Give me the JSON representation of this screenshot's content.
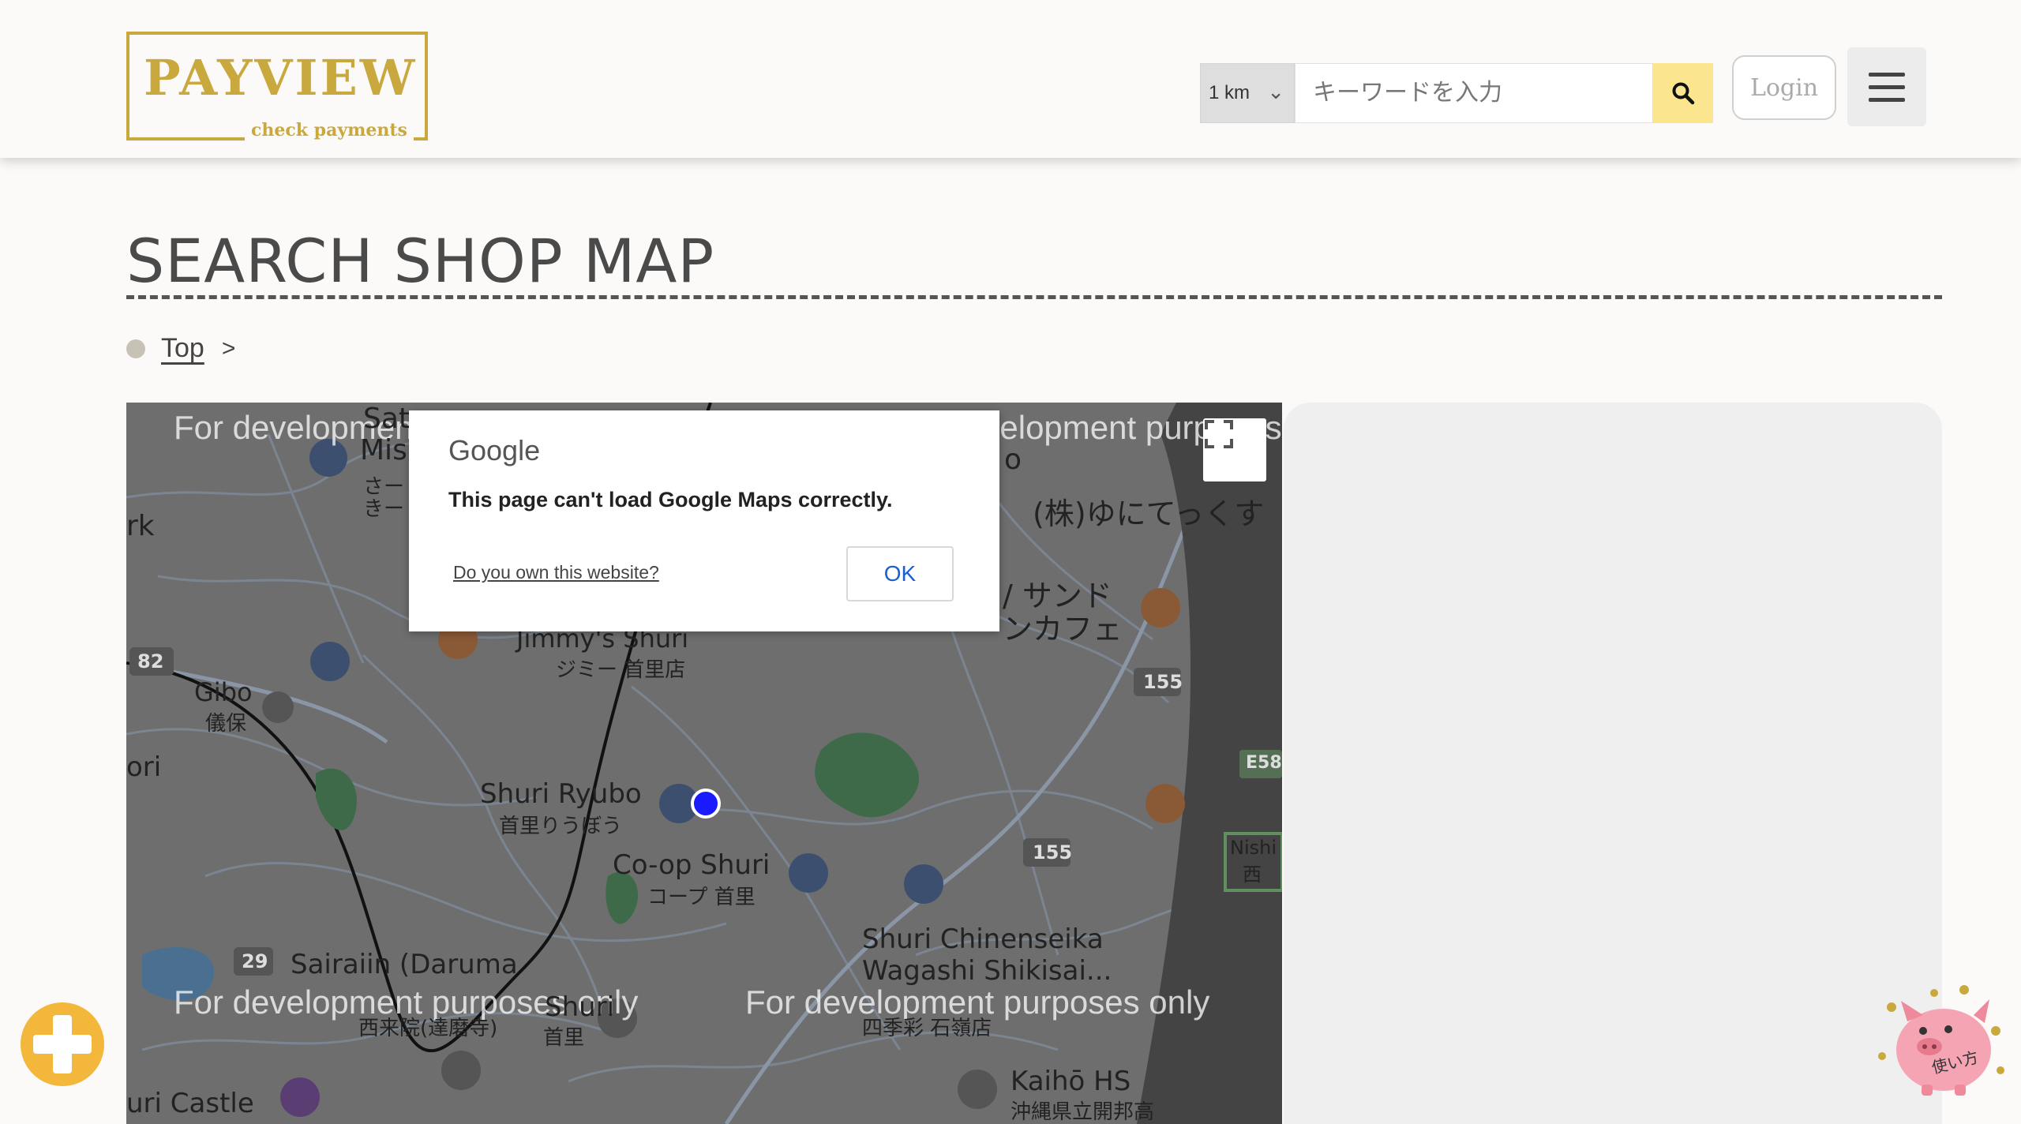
{
  "header": {
    "logo_text": "PAYVIEW",
    "logo_sub": "check payments",
    "distance_value": "1 km",
    "search_placeholder": "キーワードを入力",
    "login_label": "Login"
  },
  "page": {
    "title": "SEARCH SHOP MAP",
    "breadcrumb": [
      {
        "label": "Top"
      }
    ],
    "breadcrumb_separator": ">"
  },
  "map": {
    "watermark": "For development purposes only",
    "labels": {
      "gibo": "Gibo",
      "gibo_jp": "儀保",
      "jimmys": "Jimmy's Shuri",
      "jimmys_jp": "ジミー 首里店",
      "ryubo": "Shuri Ryubo",
      "ryubo_jp": "首里りうぼう",
      "coop": "Co-op Shuri",
      "coop_jp": "コープ 首里",
      "chinenseika": "Shuri Chinenseika",
      "wagashi": "Wagashi Shikisai...",
      "shikisai_jp": "四季彩 石嶺店",
      "sairaiin": "Sairaiin (Daruma",
      "sairaiin_jp": "西来院(達磨寺)",
      "shuri": "Shuri",
      "shuri_jp": "首里",
      "castle": "uri Castle",
      "kaiho": "Kaihō HS",
      "kaiho_jp": "沖縄県立開邦高",
      "yuniteku": "(株)ゆにてっくす",
      "sand": "/ サンド",
      "cafe": "ンカフェ",
      "nishi": "Nishi",
      "nishi_jp": "西",
      "sato": "Sat",
      "mis": "Mis",
      "rk": "rk",
      "ori": "ori",
      "o": "o",
      "sa_jp": "さー",
      "ki_jp": "きー",
      "road_82": "82",
      "road_155a": "155",
      "road_155b": "155",
      "road_29": "29",
      "road_e58": "E58"
    }
  },
  "dialog": {
    "brand": "Google",
    "message": "This page can't load Google Maps correctly.",
    "link": "Do you own this website?",
    "ok_label": "OK"
  },
  "help": {
    "label": "使い方"
  },
  "colors": {
    "brand_gold": "#c9a83e",
    "search_button": "#fbe68f",
    "map_marker": "#1a1aff",
    "plus_button": "#f3b73c"
  }
}
